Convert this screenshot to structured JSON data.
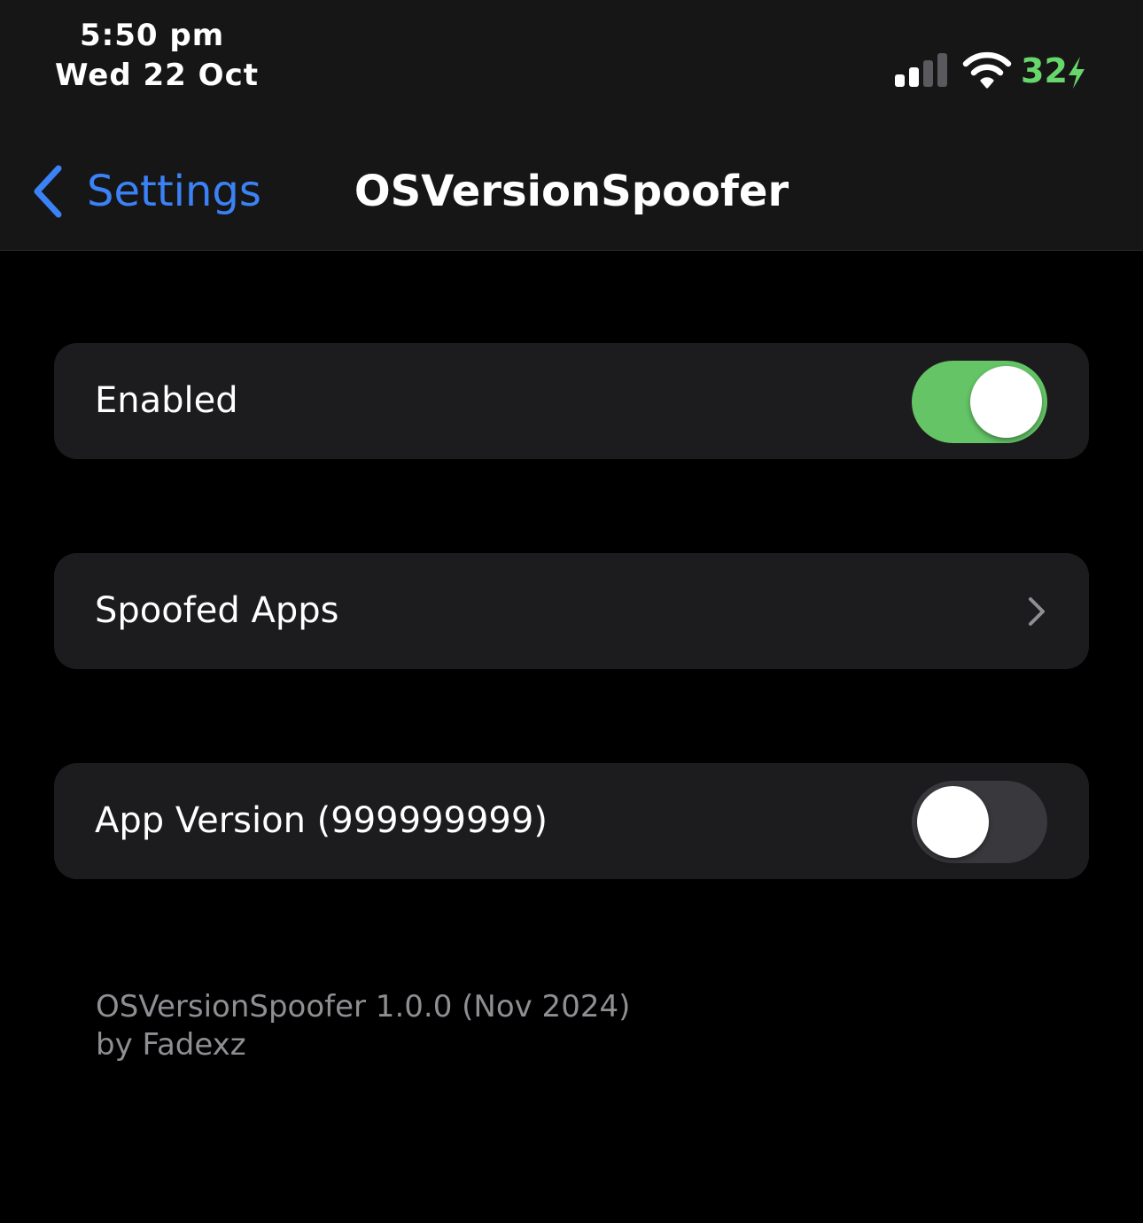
{
  "status_bar": {
    "time": "5:50 pm",
    "date": "Wed 22 Oct",
    "battery_percent": "32",
    "battery_color": "#67d66b",
    "signal_bars_active": 2,
    "signal_bars_total": 4,
    "icons": [
      "cellular-signal-icon",
      "wifi-icon",
      "charging-bolt-icon"
    ]
  },
  "nav": {
    "back_label": "Settings",
    "title": "OSVersionSpoofer",
    "back_icon": "chevron-left-icon",
    "accent_color": "#3b82f6"
  },
  "cells": {
    "enabled": {
      "label": "Enabled",
      "toggle_on": true
    },
    "spoofed_apps": {
      "label": "Spoofed Apps",
      "icon": "chevron-right-icon"
    },
    "app_version": {
      "label": "App Version (999999999)",
      "toggle_on": false
    }
  },
  "footer": {
    "line1": "OSVersionSpoofer 1.0.0 (Nov 2024)",
    "line2": "by Fadexz"
  },
  "colors": {
    "toggle_on": "#64c466",
    "toggle_off": "#39393d",
    "cell_background": "#1c1c1e"
  }
}
